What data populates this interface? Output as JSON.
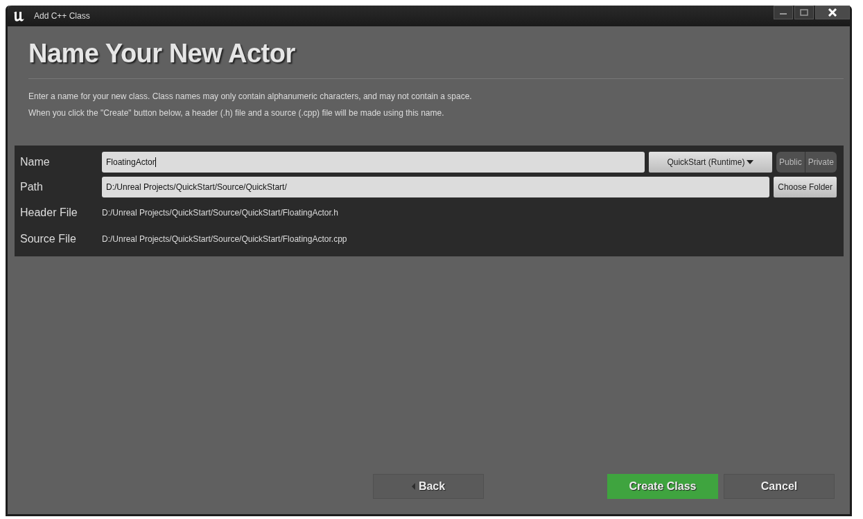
{
  "window": {
    "title": "Add C++ Class"
  },
  "heading": "Name Your New Actor",
  "description": [
    "Enter a name for your new class. Class names may only contain alphanumeric characters, and may not contain a space.",
    "When you click the \"Create\" button below, a header (.h) file and a source (.cpp) file will be made using this name."
  ],
  "form": {
    "name_label": "Name",
    "name_value": "FloatingActor",
    "module": "QuickStart (Runtime)",
    "visibility": [
      {
        "label": "Public",
        "selected": false
      },
      {
        "label": "Private",
        "selected": false
      }
    ],
    "path_label": "Path",
    "path_value": "D:/Unreal Projects/QuickStart/Source/QuickStart/",
    "choose_folder": "Choose Folder",
    "header_label": "Header File",
    "header_value": "D:/Unreal Projects/QuickStart/Source/QuickStart/FloatingActor.h",
    "source_label": "Source File",
    "source_value": "D:/Unreal Projects/QuickStart/Source/QuickStart/FloatingActor.cpp"
  },
  "buttons": [
    {
      "label": "Back",
      "kind": "back"
    },
    {
      "label": "Create Class",
      "kind": "primary"
    },
    {
      "label": "Cancel",
      "kind": "plain"
    }
  ]
}
